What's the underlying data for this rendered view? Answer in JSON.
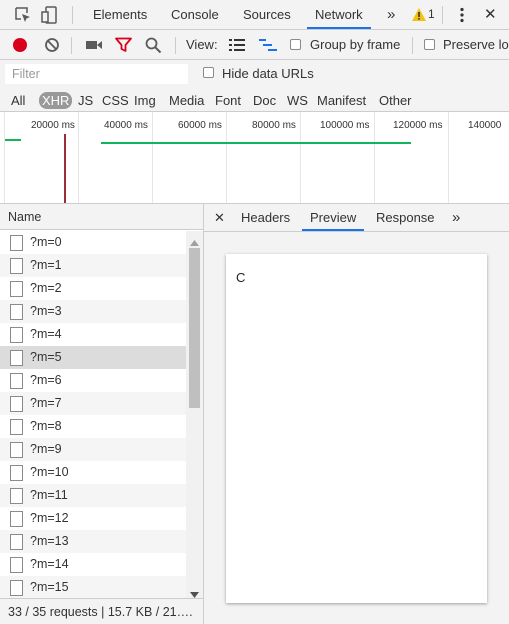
{
  "top_tabs": {
    "elements": "Elements",
    "console": "Console",
    "sources": "Sources",
    "network": "Network",
    "more": "»",
    "warning_count": "1",
    "close": "✕"
  },
  "toolbar": {
    "view_label": "View:",
    "group_by_frame": "Group by frame",
    "preserve_log": "Preserve lo"
  },
  "filter": {
    "placeholder": "Filter",
    "hide_data_urls": "Hide data URLs"
  },
  "types": [
    "All",
    "XHR",
    "JS",
    "CSS",
    "Img",
    "Media",
    "Font",
    "Doc",
    "WS",
    "Manifest",
    "Other"
  ],
  "active_type": "XHR",
  "overview": {
    "ticks": [
      "20000 ms",
      "40000 ms",
      "60000 ms",
      "80000 ms",
      "100000 ms",
      "120000 ms",
      "140000"
    ]
  },
  "requests": {
    "header": "Name",
    "items": [
      "?m=0",
      "?m=1",
      "?m=2",
      "?m=3",
      "?m=4",
      "?m=5",
      "?m=6",
      "?m=7",
      "?m=8",
      "?m=9",
      "?m=10",
      "?m=11",
      "?m=12",
      "?m=13",
      "?m=14",
      "?m=15"
    ],
    "selected": "?m=5",
    "status": "33 / 35 requests  |  15.7 KB / 21…."
  },
  "details": {
    "close": "✕",
    "headers": "Headers",
    "preview": "Preview",
    "response": "Response",
    "more": "»",
    "preview_content": "C"
  },
  "colors": {
    "accent": "#1a73e8",
    "record": "#d9001b",
    "timeline_green": "#0fb55a",
    "timeline_red": "#9b2d3a"
  }
}
